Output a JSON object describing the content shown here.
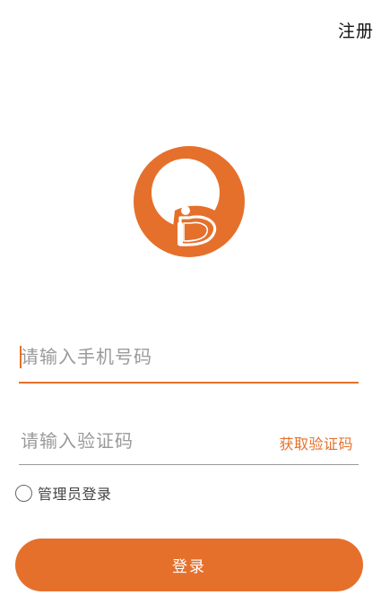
{
  "header": {
    "register_label": "注册"
  },
  "logo": {
    "icon": "app-logo-icon",
    "color": "#e5702c",
    "accent": "#ffffff"
  },
  "form": {
    "phone": {
      "placeholder": "请输入手机号码",
      "value": ""
    },
    "code": {
      "placeholder": "请输入验证码",
      "value": "",
      "get_code_label": "获取验证码"
    },
    "admin": {
      "label": "管理员登录",
      "checked": false
    },
    "login_label": "登录"
  },
  "colors": {
    "accent": "#e5702c",
    "placeholder": "#9a9a9a",
    "divider": "#9a9a9a"
  }
}
